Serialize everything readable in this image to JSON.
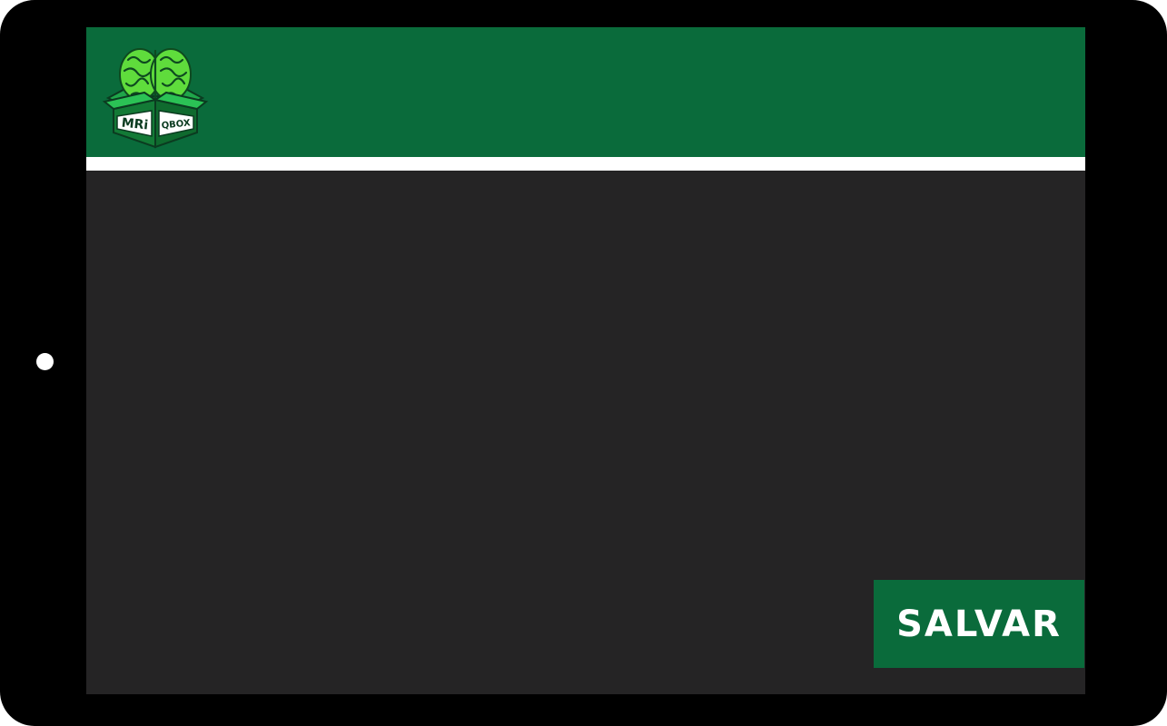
{
  "app": {
    "logo_text_left": "MRi",
    "logo_text_right": "QBOX",
    "logo_icon": "brain-in-box-logo"
  },
  "header": {
    "background_color": "#0a6b3b",
    "divider_color": "#ffffff"
  },
  "main": {
    "background_color": "#252425"
  },
  "actions": {
    "save_label": "SALVAR",
    "save_color": "#0a6b3b"
  }
}
